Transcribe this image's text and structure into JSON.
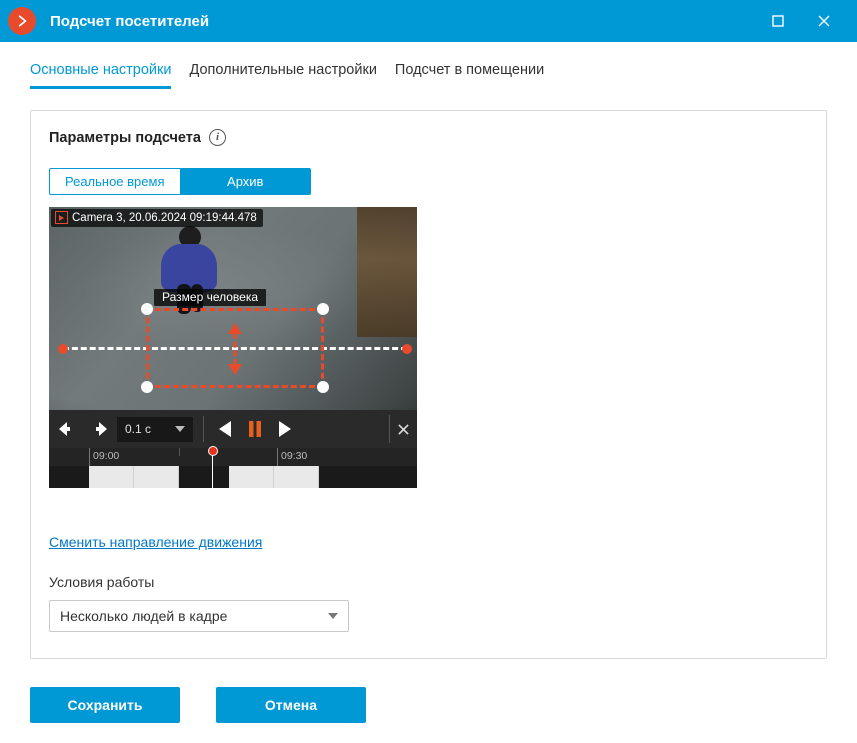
{
  "window": {
    "title": "Подсчет посетителей"
  },
  "tabs": [
    {
      "label": "Основные настройки",
      "active": true
    },
    {
      "label": "Дополнительные настройки",
      "active": false
    },
    {
      "label": "Подсчет в помещении",
      "active": false
    }
  ],
  "panel": {
    "heading": "Параметры подсчета",
    "info_tooltip": "i"
  },
  "segment": {
    "realtime": "Реальное время",
    "archive": "Архив"
  },
  "video": {
    "overlay": "Camera 3, 20.06.2024 09:19:44.478",
    "size_label": "Размер человека",
    "speed_value": "0.1 c",
    "timeline": {
      "t1": "09:00",
      "t2": "09:30"
    }
  },
  "change_direction": "Сменить направление движения",
  "conditions": {
    "label": "Условия работы",
    "value": "Несколько людей в кадре"
  },
  "footer": {
    "save": "Сохранить",
    "cancel": "Отмена"
  },
  "icons": {
    "logo": "chevron-right",
    "maximize": "maximize",
    "close": "close"
  }
}
